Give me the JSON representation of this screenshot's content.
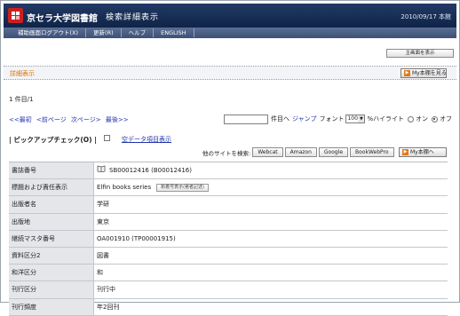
{
  "header": {
    "library_name": "京セラ大学図書館",
    "page_mode": "検索詳細表示",
    "date": "2010/09/17 本館"
  },
  "nav": [
    "補助画面ログアウト(X)",
    "更新(R)",
    "ヘルプ",
    "ENGLISH"
  ],
  "toolbar": {
    "main_screen_button": "主画面を表示"
  },
  "section": {
    "title": "詳細表示",
    "mybook_button": "My本棚を見る"
  },
  "result": {
    "count": "1 件目/1"
  },
  "pager": {
    "first": "<<最初",
    "prev": "<前ページ",
    "next": "次ページ>",
    "last": "最後>>",
    "jump_suffix": "件目へ",
    "jump_link": "ジャンプ",
    "font_label": "フォント",
    "font_value": "100",
    "highlight_label": "%ハイライト",
    "on_label": "オン",
    "off_label": "オフ"
  },
  "pickup": {
    "label": "| ピックアップチェック(O) |",
    "empty_data_link": "空データ項目表示"
  },
  "search_other": {
    "label": "他のサイトを検索:",
    "buttons": [
      "Webcat",
      "Amazon",
      "Google",
      "BookWebPro"
    ],
    "mybook_add": "My本棚へ"
  },
  "detail": [
    {
      "label": "書誌番号",
      "value": "SB00012416 (B00012416)"
    },
    {
      "label": "標題および責任表示",
      "value": "Elfin books series",
      "button": "新着号表示(著者記述)"
    },
    {
      "label": "出版者名",
      "value": "学研"
    },
    {
      "label": "出版地",
      "value": "東京"
    },
    {
      "label": "継続マスタ番号",
      "value": "OA001910 (TP00001915)"
    },
    {
      "label": "資料区分2",
      "value": "図書"
    },
    {
      "label": "和洋区分",
      "value": "和"
    },
    {
      "label": "刊行区分",
      "value": "刊行中"
    },
    {
      "label": "刊行頻度",
      "value": "年2回刊"
    }
  ],
  "colors": {
    "header": "#1b3157",
    "accent": "#e07000",
    "link": "#2233aa"
  }
}
